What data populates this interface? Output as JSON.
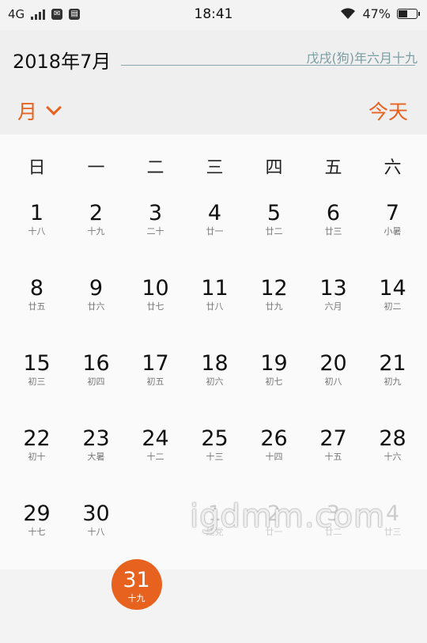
{
  "status_bar": {
    "network": "4G",
    "time": "18:41",
    "battery": "47%",
    "battery_level": 0.47,
    "icons": [
      "signal-icon",
      "app-notification-icon",
      "sim-icon",
      "wifi-icon",
      "battery-icon"
    ]
  },
  "header": {
    "month_title": "2018年7月",
    "lunar_info": "戊戌(狗)年六月十九",
    "view_mode": "月",
    "today_button": "今天"
  },
  "weekdays": [
    "日",
    "一",
    "二",
    "三",
    "四",
    "五",
    "六"
  ],
  "days": [
    {
      "num": "1",
      "lunar": "十八"
    },
    {
      "num": "2",
      "lunar": "十九"
    },
    {
      "num": "3",
      "lunar": "二十"
    },
    {
      "num": "4",
      "lunar": "廿一"
    },
    {
      "num": "5",
      "lunar": "廿二"
    },
    {
      "num": "6",
      "lunar": "廿三"
    },
    {
      "num": "7",
      "lunar": "小暑"
    },
    {
      "num": "8",
      "lunar": "廿五"
    },
    {
      "num": "9",
      "lunar": "廿六"
    },
    {
      "num": "10",
      "lunar": "廿七"
    },
    {
      "num": "11",
      "lunar": "廿八"
    },
    {
      "num": "12",
      "lunar": "廿九"
    },
    {
      "num": "13",
      "lunar": "六月"
    },
    {
      "num": "14",
      "lunar": "初二"
    },
    {
      "num": "15",
      "lunar": "初三"
    },
    {
      "num": "16",
      "lunar": "初四"
    },
    {
      "num": "17",
      "lunar": "初五"
    },
    {
      "num": "18",
      "lunar": "初六"
    },
    {
      "num": "19",
      "lunar": "初七"
    },
    {
      "num": "20",
      "lunar": "初八"
    },
    {
      "num": "21",
      "lunar": "初九"
    },
    {
      "num": "22",
      "lunar": "初十"
    },
    {
      "num": "23",
      "lunar": "大暑"
    },
    {
      "num": "24",
      "lunar": "十二"
    },
    {
      "num": "25",
      "lunar": "十三"
    },
    {
      "num": "26",
      "lunar": "十四"
    },
    {
      "num": "27",
      "lunar": "十五"
    },
    {
      "num": "28",
      "lunar": "十六"
    },
    {
      "num": "29",
      "lunar": "十七"
    },
    {
      "num": "30",
      "lunar": "十八"
    },
    {
      "num": "31",
      "lunar": "十九",
      "today": true
    },
    {
      "num": "1",
      "lunar": "建党",
      "other": true
    },
    {
      "num": "2",
      "lunar": "廿一",
      "other": true
    },
    {
      "num": "3",
      "lunar": "廿二",
      "other": true
    },
    {
      "num": "4",
      "lunar": "廿三",
      "other": true
    }
  ],
  "watermark": "igdmm.com",
  "colors": {
    "accent": "#e8621f",
    "lunar_text": "#7a9da2"
  }
}
